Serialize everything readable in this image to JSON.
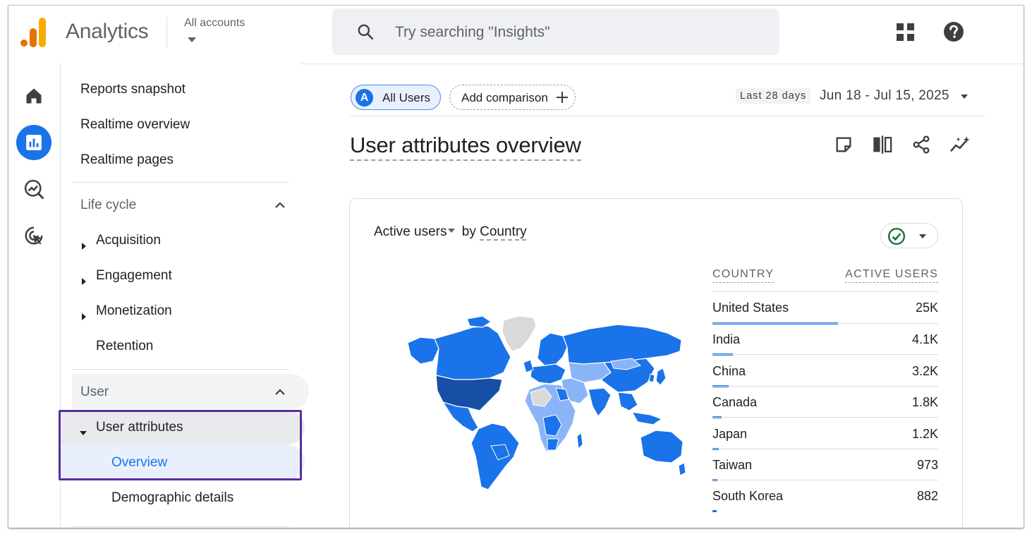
{
  "app": {
    "title": "Analytics",
    "accounts_label": "All accounts"
  },
  "search": {
    "placeholder": "Try searching \"Insights\""
  },
  "nav": {
    "items_top": [
      "Reports snapshot",
      "Realtime overview",
      "Realtime pages"
    ],
    "lifecycle": {
      "label": "Life cycle",
      "items": [
        "Acquisition",
        "Engagement",
        "Monetization",
        "Retention"
      ]
    },
    "user": {
      "label": "User",
      "user_attributes": "User attributes",
      "overview": "Overview",
      "demographic_details": "Demographic details"
    }
  },
  "toolbar": {
    "segment": "All Users",
    "segment_avatar": "A",
    "add_comparison": "Add comparison",
    "date_tag": "Last 28 days",
    "date_range": "Jun 18 - Jul 15, 2025"
  },
  "page": {
    "title": "User attributes overview"
  },
  "card": {
    "metric": "Active users",
    "by": "by",
    "dimension": "Country",
    "col_country": "COUNTRY",
    "col_users": "ACTIVE USERS",
    "rows": [
      {
        "country": "United States",
        "value": "25K",
        "share": 1.0
      },
      {
        "country": "India",
        "value": "4.1K",
        "share": 0.164
      },
      {
        "country": "China",
        "value": "3.2K",
        "share": 0.128
      },
      {
        "country": "Canada",
        "value": "1.8K",
        "share": 0.072
      },
      {
        "country": "Japan",
        "value": "1.2K",
        "share": 0.048
      },
      {
        "country": "Taiwan",
        "value": "973",
        "share": 0.039
      },
      {
        "country": "South Korea",
        "value": "882",
        "share": 0.035
      }
    ]
  },
  "colors": {
    "accent": "#1a73e8",
    "highlight_box": "#5b2d9f",
    "map_dark": "#174ea6",
    "map_mid": "#1a73e8",
    "map_light": "#8ab4f8",
    "map_none": "#d9d9d9"
  }
}
